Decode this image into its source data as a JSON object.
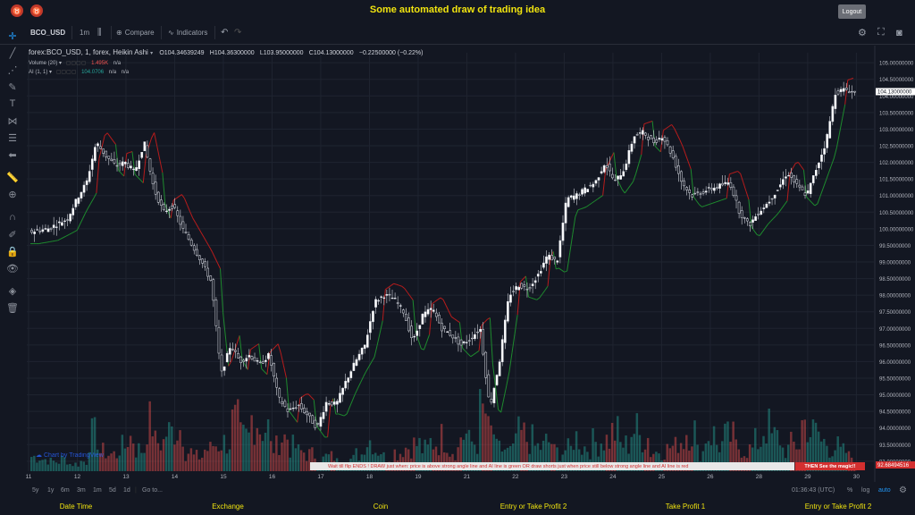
{
  "app": {
    "title": "Some automated draw of trading idea",
    "logout_label": "Logout"
  },
  "toolbar": {
    "symbol": "BCO_USD",
    "interval": "1m",
    "compare_label": "Compare",
    "indicators_label": "Indicators"
  },
  "legend": {
    "symbol_line": "forex:BCO_USD, 1, forex, Heikin Ashi",
    "o_label": "O",
    "o_value": "104.34639249",
    "h_label": "H",
    "h_value": "104.36300000",
    "l_label": "L",
    "l_value": "103.95000000",
    "c_label": "C",
    "c_value": "104.13000000",
    "change": "−0.22500000 (−0.22%)",
    "volume_label": "Volume (20)",
    "volume_value": "1.495K",
    "volume_na": "n/a",
    "ai_label": "AI (1, 1)",
    "ai_value": "104.0706",
    "ai_na1": "n/a",
    "ai_na2": "n/a"
  },
  "chart_data": {
    "type": "candlestick",
    "chart_style": "Heikin Ashi",
    "x_tick_labels": [
      "11",
      "12",
      "13",
      "14",
      "15",
      "16",
      "17",
      "18",
      "19",
      "21",
      "22",
      "23",
      "24",
      "25",
      "26",
      "28",
      "29",
      "30"
    ],
    "y_tick_labels": [
      "105.00000000",
      "104.50000000",
      "104.00000000",
      "103.50000000",
      "103.00000000",
      "102.50000000",
      "102.00000000",
      "101.50000000",
      "101.00000000",
      "100.50000000",
      "100.00000000",
      "99.50000000",
      "99.00000000",
      "98.50000000",
      "98.00000000",
      "97.50000000",
      "97.00000000",
      "96.50000000",
      "96.00000000",
      "95.50000000",
      "95.00000000",
      "94.50000000",
      "94.00000000",
      "93.50000000",
      "93.00000000"
    ],
    "ylim": [
      92.7,
      105.3
    ],
    "last_price": "104.13000000",
    "ai_last": "92.68494516",
    "price_path": [
      [
        0,
        99.9
      ],
      [
        2,
        100.0
      ],
      [
        4,
        100.3
      ],
      [
        5,
        100.9
      ],
      [
        6,
        101.4
      ],
      [
        7,
        102.6
      ],
      [
        8,
        102.2
      ],
      [
        9,
        101.9
      ],
      [
        10,
        102.0
      ],
      [
        11,
        101.7
      ],
      [
        12,
        102.6
      ],
      [
        13,
        101.2
      ],
      [
        14,
        100.5
      ],
      [
        15,
        100.7
      ],
      [
        16,
        100.0
      ],
      [
        17,
        99.5
      ],
      [
        18,
        99.0
      ],
      [
        19,
        98.4
      ],
      [
        20,
        95.6
      ],
      [
        21,
        96.5
      ],
      [
        22,
        96.0
      ],
      [
        23,
        96.2
      ],
      [
        24,
        95.9
      ],
      [
        25,
        96.2
      ],
      [
        26,
        94.9
      ],
      [
        27,
        94.5
      ],
      [
        28,
        94.7
      ],
      [
        29,
        94.4
      ],
      [
        30,
        94.0
      ],
      [
        31,
        94.8
      ],
      [
        32,
        94.7
      ],
      [
        33,
        95.4
      ],
      [
        34,
        96.0
      ],
      [
        35,
        96.5
      ],
      [
        36,
        97.8
      ],
      [
        37,
        98.0
      ],
      [
        38,
        97.9
      ],
      [
        39,
        97.5
      ],
      [
        40,
        96.6
      ],
      [
        41,
        97.4
      ],
      [
        42,
        97.6
      ],
      [
        43,
        97.0
      ],
      [
        44,
        96.8
      ],
      [
        45,
        96.5
      ],
      [
        46,
        96.7
      ],
      [
        47,
        97.0
      ],
      [
        48,
        94.6
      ],
      [
        49,
        96.0
      ],
      [
        50,
        98.0
      ],
      [
        51,
        98.3
      ],
      [
        52,
        98.2
      ],
      [
        53,
        98.6
      ],
      [
        54,
        99.2
      ],
      [
        55,
        99.0
      ],
      [
        56,
        100.9
      ],
      [
        57,
        101.0
      ],
      [
        58,
        101.2
      ],
      [
        59,
        101.4
      ],
      [
        60,
        102.0
      ],
      [
        61,
        101.4
      ],
      [
        62,
        101.8
      ],
      [
        63,
        102.8
      ],
      [
        64,
        102.9
      ],
      [
        65,
        102.6
      ],
      [
        66,
        102.8
      ],
      [
        67,
        102.2
      ],
      [
        68,
        101.4
      ],
      [
        69,
        101.0
      ],
      [
        70,
        101.1
      ],
      [
        71,
        101.2
      ],
      [
        72,
        101.3
      ],
      [
        73,
        101.4
      ],
      [
        74,
        100.5
      ],
      [
        75,
        100.1
      ],
      [
        76,
        100.5
      ],
      [
        77,
        100.8
      ],
      [
        78,
        101.2
      ],
      [
        79,
        101.7
      ],
      [
        80,
        101.3
      ],
      [
        81,
        101.0
      ],
      [
        82,
        101.8
      ],
      [
        83,
        102.6
      ],
      [
        84,
        104.1
      ],
      [
        85,
        104.2
      ],
      [
        86,
        104.1
      ]
    ],
    "volume": [
      6,
      5,
      4,
      5,
      3,
      4,
      15,
      8,
      7,
      10,
      14,
      9,
      20,
      12,
      16,
      18,
      8,
      6,
      9,
      11,
      12,
      20,
      14,
      22,
      18,
      10,
      14,
      10,
      8,
      7,
      5,
      6,
      4,
      5,
      7,
      13,
      9,
      6,
      8,
      10,
      11,
      9,
      12,
      14,
      9,
      15,
      12,
      24,
      16,
      9,
      8,
      15,
      13,
      10,
      12,
      8,
      9,
      14,
      10,
      12,
      13,
      16,
      11,
      17,
      14,
      8,
      9,
      10,
      13,
      17,
      8,
      15,
      11,
      14,
      10,
      9,
      12,
      18,
      14,
      9,
      11,
      20,
      16,
      12,
      10,
      8,
      6
    ]
  },
  "banner": {
    "left_text": "Wait till flip ENDS  !    DRAW just when:  price is above strong angle line and AI line is green       OR       draw shorts just when price still below strong angle line and AI line is red",
    "right_text": "THEN See the magic!!"
  },
  "watermark": "Chart by TradingView",
  "bottombar": {
    "ranges": [
      "5y",
      "1y",
      "6m",
      "3m",
      "1m",
      "5d",
      "1d"
    ],
    "goto_label": "Go to...",
    "clock": "01:36:43 (UTC)",
    "percent_label": "%",
    "log_label": "log",
    "auto_label": "auto"
  },
  "footer": {
    "labels": [
      "Date Time",
      "Exchange",
      "Coin",
      "Entry or Take Profit 2",
      "Take Profit 1",
      "Entry or Take Profit 2"
    ]
  },
  "colors": {
    "up": "#26a69a",
    "down": "#ef5350",
    "ai_green": "#1e8a2e",
    "ai_red": "#b71c1c",
    "accent": "#f1e40f",
    "bg": "#131722"
  }
}
